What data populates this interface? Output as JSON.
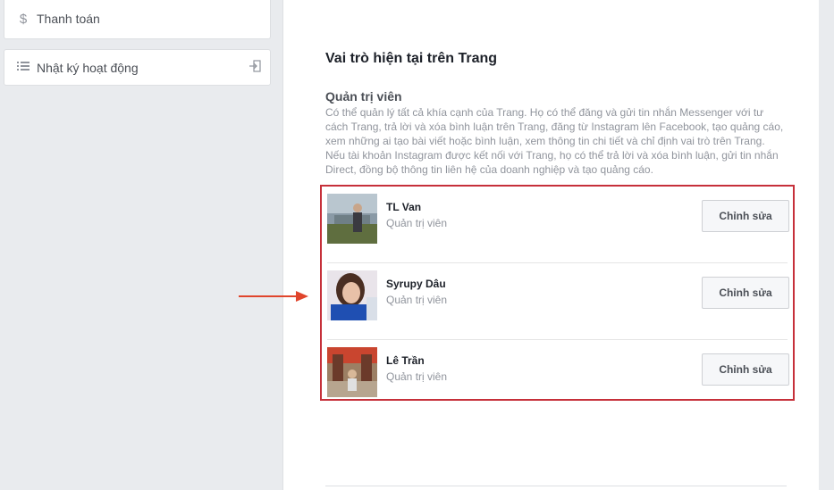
{
  "sidebar": {
    "items": [
      {
        "label": "Thanh toán",
        "icon": "dollar-icon"
      },
      {
        "label": "Nhật ký hoạt động",
        "icon": "list-icon",
        "end_icon": "exit-icon"
      }
    ]
  },
  "main": {
    "section_title": "Vai trò hiện tại trên Trang",
    "role_title": "Quản trị viên",
    "role_description": "Có thể quản lý tất cả khía cạnh của Trang. Họ có thể đăng và gửi tin nhắn Messenger với tư cách Trang, trả lời và xóa bình luận trên Trang, đăng từ Instagram lên Facebook, tạo quảng cáo, xem những ai tạo bài viết hoặc bình luận, xem thông tin chi tiết và chỉ định vai trò trên Trang. Nếu tài khoản Instagram được kết nối với Trang, họ có thể trả lời và xóa bình luận, gửi tin nhắn Direct, đồng bộ thông tin liên hệ của doanh nghiệp và tạo quảng cáo.",
    "people": [
      {
        "name": "TL Van",
        "role": "Quản trị viên",
        "edit_label": "Chỉnh sửa"
      },
      {
        "name": "Syrupy Dâu",
        "role": "Quản trị viên",
        "edit_label": "Chỉnh sửa"
      },
      {
        "name": "Lê Trần",
        "role": "Quản trị viên",
        "edit_label": "Chỉnh sửa"
      }
    ]
  },
  "colors": {
    "highlight_border": "#c6303a",
    "arrow": "#e0452c"
  }
}
